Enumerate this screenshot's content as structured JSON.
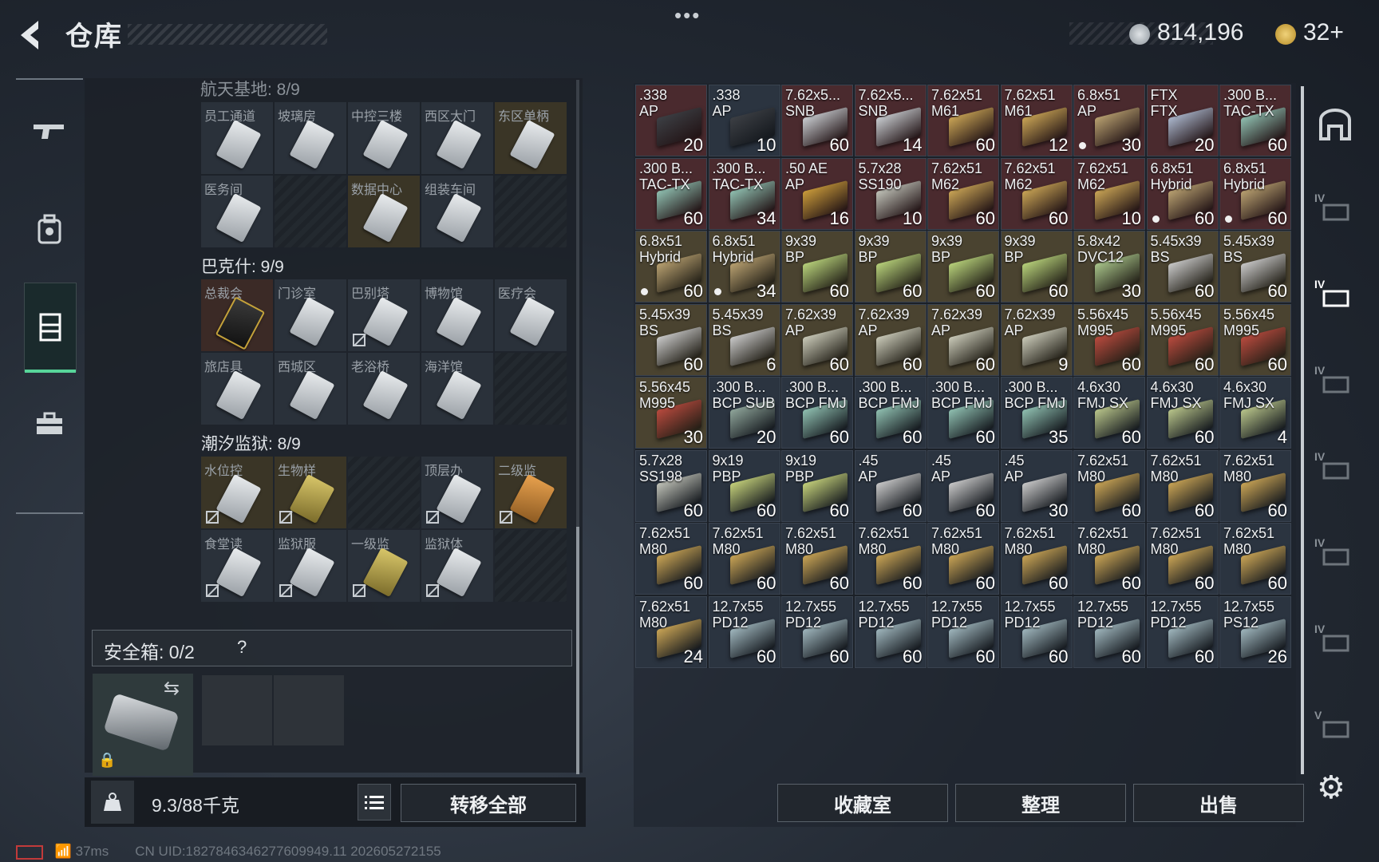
{
  "header": {
    "title": "仓库",
    "silver": "814,196",
    "gold": "32+"
  },
  "storage": {
    "section0_label": "航天基地: 8/9",
    "sections": [
      {
        "label": "巴克什: 9/9"
      },
      {
        "label": "潮汐监狱: 8/9"
      }
    ],
    "grid0": [
      "员工通道",
      "坡璃房",
      "中控三楼",
      "西区大门",
      "东区单柄",
      "医务间",
      "",
      "数据中心",
      "组装车间",
      ""
    ],
    "grid1": [
      "总裁会",
      "门诊室",
      "巴别塔",
      "博物馆",
      "医疗会",
      "旅店具",
      "西城区",
      "老浴桥",
      "海洋馆",
      ""
    ],
    "grid2": [
      "水位控",
      "生物样",
      "",
      "顶层办",
      "二级监",
      "食堂读",
      "监狱服",
      "一级监",
      "监狱体",
      ""
    ],
    "safe_label": "安全箱: 0/2",
    "safe_help": "?",
    "weight": "9.3/88千克",
    "transfer_all": "转移全部"
  },
  "ammo": [
    {
      "n": ".338\nAP",
      "c": "20",
      "k": "red",
      "b": "#3c3f44"
    },
    {
      "n": ".338\nAP",
      "c": "10",
      "k": "",
      "b": "#3c3f44"
    },
    {
      "n": "7.62x5...\nSNB",
      "c": "60",
      "k": "red",
      "b": "#c8ccd0"
    },
    {
      "n": "7.62x5...\nSNB",
      "c": "14",
      "k": "red",
      "b": "#c8ccd0"
    },
    {
      "n": "7.62x51\nM61",
      "c": "60",
      "k": "red",
      "b": "#c9a455"
    },
    {
      "n": "7.62x51\nM61",
      "c": "12",
      "k": "red",
      "b": "#c9a455"
    },
    {
      "n": "6.8x51\nAP",
      "c": "30",
      "k": "red",
      "b": "#b8a070",
      "d": true
    },
    {
      "n": "FTX\nFTX",
      "c": "20",
      "k": "red",
      "b": "#aab6cc"
    },
    {
      "n": ".300 B...\nTAC-TX",
      "c": "60",
      "k": "red",
      "b": "#8fbfb0"
    },
    {
      "n": ".300 B...\nTAC-TX",
      "c": "60",
      "k": "red",
      "b": "#8fbfb0"
    },
    {
      "n": ".300 B...\nTAC-TX",
      "c": "34",
      "k": "red",
      "b": "#8fbfb0"
    },
    {
      "n": ".50 AE\nAP",
      "c": "16",
      "k": "red",
      "b": "#c99a3a"
    },
    {
      "n": "5.7x28\nSS190",
      "c": "10",
      "k": "red",
      "b": "#c0c2b8"
    },
    {
      "n": "7.62x51\nM62",
      "c": "60",
      "k": "red",
      "b": "#c9a455"
    },
    {
      "n": "7.62x51\nM62",
      "c": "60",
      "k": "red",
      "b": "#c9a455"
    },
    {
      "n": "7.62x51\nM62",
      "c": "10",
      "k": "red",
      "b": "#c9a455"
    },
    {
      "n": "6.8x51\nHybrid",
      "c": "60",
      "k": "red",
      "b": "#b8a070",
      "d": true
    },
    {
      "n": "6.8x51\nHybrid",
      "c": "60",
      "k": "red",
      "b": "#b8a070",
      "d": true
    },
    {
      "n": "6.8x51\nHybrid",
      "c": "60",
      "k": "yel",
      "b": "#b8a070",
      "d": true
    },
    {
      "n": "6.8x51\nHybrid",
      "c": "34",
      "k": "yel",
      "b": "#b8a070",
      "d": true
    },
    {
      "n": "9x39\nBP",
      "c": "60",
      "k": "yel",
      "b": "#b7d17a"
    },
    {
      "n": "9x39\nBP",
      "c": "60",
      "k": "yel",
      "b": "#b7d17a"
    },
    {
      "n": "9x39\nBP",
      "c": "60",
      "k": "yel",
      "b": "#b7d17a"
    },
    {
      "n": "9x39\nBP",
      "c": "60",
      "k": "yel",
      "b": "#b7d17a"
    },
    {
      "n": "5.8x42\nDVC12",
      "c": "30",
      "k": "yel",
      "b": "#a8c48a"
    },
    {
      "n": "5.45x39\nBS",
      "c": "60",
      "k": "yel",
      "b": "#c8c8c8"
    },
    {
      "n": "5.45x39\nBS",
      "c": "60",
      "k": "yel",
      "b": "#c8c8c8"
    },
    {
      "n": "5.45x39\nBS",
      "c": "60",
      "k": "yel",
      "b": "#c8c8c8"
    },
    {
      "n": "5.45x39\nBS",
      "c": "6",
      "k": "yel",
      "b": "#c8c8c8"
    },
    {
      "n": "7.62x39\nAP",
      "c": "60",
      "k": "yel",
      "b": "#c9c9b8"
    },
    {
      "n": "7.62x39\nAP",
      "c": "60",
      "k": "yel",
      "b": "#c9c9b8"
    },
    {
      "n": "7.62x39\nAP",
      "c": "60",
      "k": "yel",
      "b": "#c9c9b8"
    },
    {
      "n": "7.62x39\nAP",
      "c": "9",
      "k": "yel",
      "b": "#c9c9b8"
    },
    {
      "n": "5.56x45\nM995",
      "c": "60",
      "k": "yel",
      "b": "#b84a3e"
    },
    {
      "n": "5.56x45\nM995",
      "c": "60",
      "k": "yel",
      "b": "#b84a3e"
    },
    {
      "n": "5.56x45\nM995",
      "c": "60",
      "k": "yel",
      "b": "#b84a3e"
    },
    {
      "n": "5.56x45\nM995",
      "c": "30",
      "k": "yel",
      "b": "#b84a3e"
    },
    {
      "n": ".300 B...\nBCP SUB",
      "c": "20",
      "k": "",
      "b": "#8fa59a"
    },
    {
      "n": ".300 B...\nBCP FMJ",
      "c": "60",
      "k": "",
      "b": "#8fbfb0"
    },
    {
      "n": ".300 B...\nBCP FMJ",
      "c": "60",
      "k": "",
      "b": "#8fbfb0"
    },
    {
      "n": ".300 B...\nBCP FMJ",
      "c": "60",
      "k": "",
      "b": "#8fbfb0"
    },
    {
      "n": ".300 B...\nBCP FMJ",
      "c": "35",
      "k": "",
      "b": "#8fbfb0"
    },
    {
      "n": "4.6x30\nFMJ SX",
      "c": "60",
      "k": "",
      "b": "#b8c48a"
    },
    {
      "n": "4.6x30\nFMJ SX",
      "c": "60",
      "k": "",
      "b": "#b8c48a"
    },
    {
      "n": "4.6x30\nFMJ SX",
      "c": "4",
      "k": "",
      "b": "#b8c48a"
    },
    {
      "n": "5.7x28\nSS198",
      "c": "60",
      "k": "",
      "b": "#c0c2b8"
    },
    {
      "n": "9x19\nPBP",
      "c": "60",
      "k": "",
      "b": "#c4d07a"
    },
    {
      "n": "9x19\nPBP",
      "c": "60",
      "k": "",
      "b": "#c4d07a"
    },
    {
      "n": ".45\nAP",
      "c": "60",
      "k": "",
      "b": "#c8c8c8"
    },
    {
      "n": ".45\nAP",
      "c": "60",
      "k": "",
      "b": "#c8c8c8"
    },
    {
      "n": ".45\nAP",
      "c": "30",
      "k": "",
      "b": "#c8c8c8"
    },
    {
      "n": "7.62x51\nM80",
      "c": "60",
      "k": "",
      "b": "#c9a455"
    },
    {
      "n": "7.62x51\nM80",
      "c": "60",
      "k": "",
      "b": "#c9a455"
    },
    {
      "n": "7.62x51\nM80",
      "c": "60",
      "k": "",
      "b": "#c9a455"
    },
    {
      "n": "7.62x51\nM80",
      "c": "60",
      "k": "",
      "b": "#c9a455"
    },
    {
      "n": "7.62x51\nM80",
      "c": "60",
      "k": "",
      "b": "#c9a455"
    },
    {
      "n": "7.62x51\nM80",
      "c": "60",
      "k": "",
      "b": "#c9a455"
    },
    {
      "n": "7.62x51\nM80",
      "c": "60",
      "k": "",
      "b": "#c9a455"
    },
    {
      "n": "7.62x51\nM80",
      "c": "60",
      "k": "",
      "b": "#c9a455"
    },
    {
      "n": "7.62x51\nM80",
      "c": "60",
      "k": "",
      "b": "#c9a455"
    },
    {
      "n": "7.62x51\nM80",
      "c": "60",
      "k": "",
      "b": "#c9a455"
    },
    {
      "n": "7.62x51\nM80",
      "c": "60",
      "k": "",
      "b": "#c9a455"
    },
    {
      "n": "7.62x51\nM80",
      "c": "60",
      "k": "",
      "b": "#c9a455"
    },
    {
      "n": "7.62x51\nM80",
      "c": "24",
      "k": "",
      "b": "#c9a455"
    },
    {
      "n": "12.7x55\nPD12",
      "c": "60",
      "k": "",
      "b": "#9fb6bd"
    },
    {
      "n": "12.7x55\nPD12",
      "c": "60",
      "k": "",
      "b": "#9fb6bd"
    },
    {
      "n": "12.7x55\nPD12",
      "c": "60",
      "k": "",
      "b": "#9fb6bd"
    },
    {
      "n": "12.7x55\nPD12",
      "c": "60",
      "k": "",
      "b": "#9fb6bd"
    },
    {
      "n": "12.7x55\nPD12",
      "c": "60",
      "k": "",
      "b": "#9fb6bd"
    },
    {
      "n": "12.7x55\nPD12",
      "c": "60",
      "k": "",
      "b": "#9fb6bd"
    },
    {
      "n": "12.7x55\nPD12",
      "c": "60",
      "k": "",
      "b": "#9fb6bd"
    },
    {
      "n": "12.7x55\nPS12",
      "c": "26",
      "k": "",
      "b": "#9fb6bd"
    }
  ],
  "bottom": {
    "collection": "收藏室",
    "sort": "整理",
    "sell": "出售"
  },
  "rail": [
    "",
    "IV",
    "IV",
    "IV",
    "IV",
    "IV",
    "IV",
    "V"
  ],
  "status": {
    "ping": "37ms",
    "uid": "CN UID:1827846346277609949.11 202605272155"
  }
}
